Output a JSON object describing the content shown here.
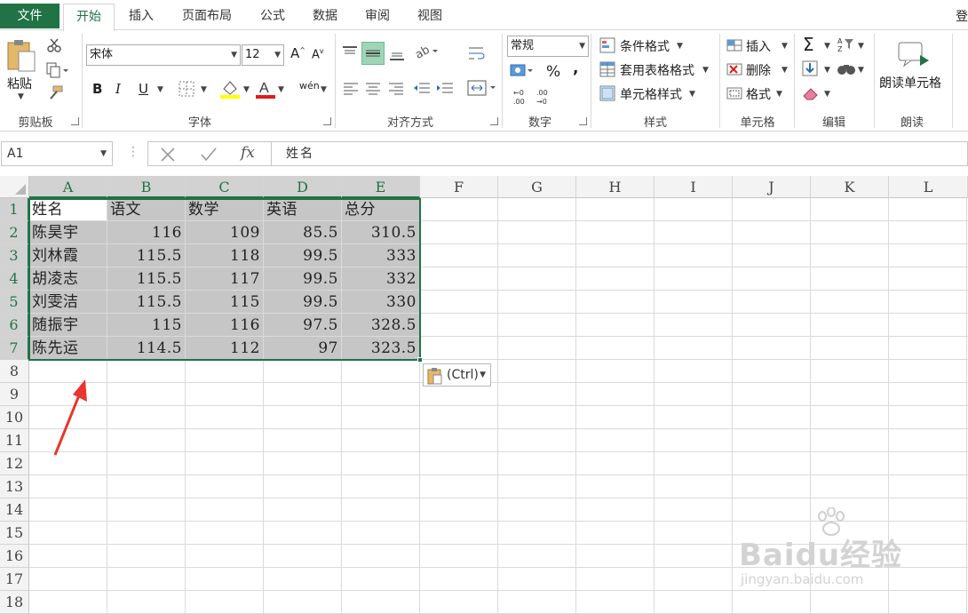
{
  "tabs": {
    "file": "文件",
    "items": [
      "开始",
      "插入",
      "页面布局",
      "公式",
      "数据",
      "审阅",
      "视图"
    ],
    "login": "登"
  },
  "ribbon": {
    "clipboard": {
      "paste": "粘贴",
      "label": "剪贴板"
    },
    "font": {
      "name": "宋体",
      "size": "12",
      "label": "字体"
    },
    "alignment": {
      "label": "对齐方式"
    },
    "number": {
      "format": "常规",
      "percent": "%",
      "comma": ",",
      "label": "数字"
    },
    "styles": {
      "conditional": "条件格式",
      "table": "套用表格格式",
      "cell": "单元格样式",
      "label": "样式"
    },
    "cells": {
      "insert": "插入",
      "delete": "删除",
      "format": "格式",
      "label": "单元格"
    },
    "editing": {
      "label": "编辑"
    },
    "readaloud": {
      "button": "朗读单元格",
      "label": "朗读"
    }
  },
  "formula_bar": {
    "name_box": "A1",
    "formula": "姓名",
    "fx": "fx"
  },
  "columns": [
    "A",
    "B",
    "C",
    "D",
    "E",
    "F",
    "G",
    "H",
    "I",
    "J",
    "K",
    "L"
  ],
  "rows": [
    "1",
    "2",
    "3",
    "4",
    "5",
    "6",
    "7",
    "8",
    "9",
    "10",
    "11",
    "12",
    "13",
    "14",
    "15",
    "16",
    "17",
    "18"
  ],
  "table": {
    "header": [
      "姓名",
      "语文",
      "数学",
      "英语",
      "总分"
    ],
    "data": [
      [
        "陈昊宇",
        "116",
        "109",
        "85.5",
        "310.5"
      ],
      [
        "刘林霞",
        "115.5",
        "118",
        "99.5",
        "333"
      ],
      [
        "胡凌志",
        "115.5",
        "117",
        "99.5",
        "332"
      ],
      [
        "刘雯洁",
        "115.5",
        "115",
        "99.5",
        "330"
      ],
      [
        "随振宇",
        "115",
        "116",
        "97.5",
        "328.5"
      ],
      [
        "陈先运",
        "114.5",
        "112",
        "97",
        "323.5"
      ]
    ]
  },
  "paste_options": {
    "label": "(Ctrl)"
  },
  "watermark": {
    "brand": "Baidu经验",
    "url": "jingyan.baidu.com"
  },
  "colors": {
    "accent": "#217346",
    "selection_fill": "#c6c6c6",
    "arrow": "#e8352d"
  }
}
